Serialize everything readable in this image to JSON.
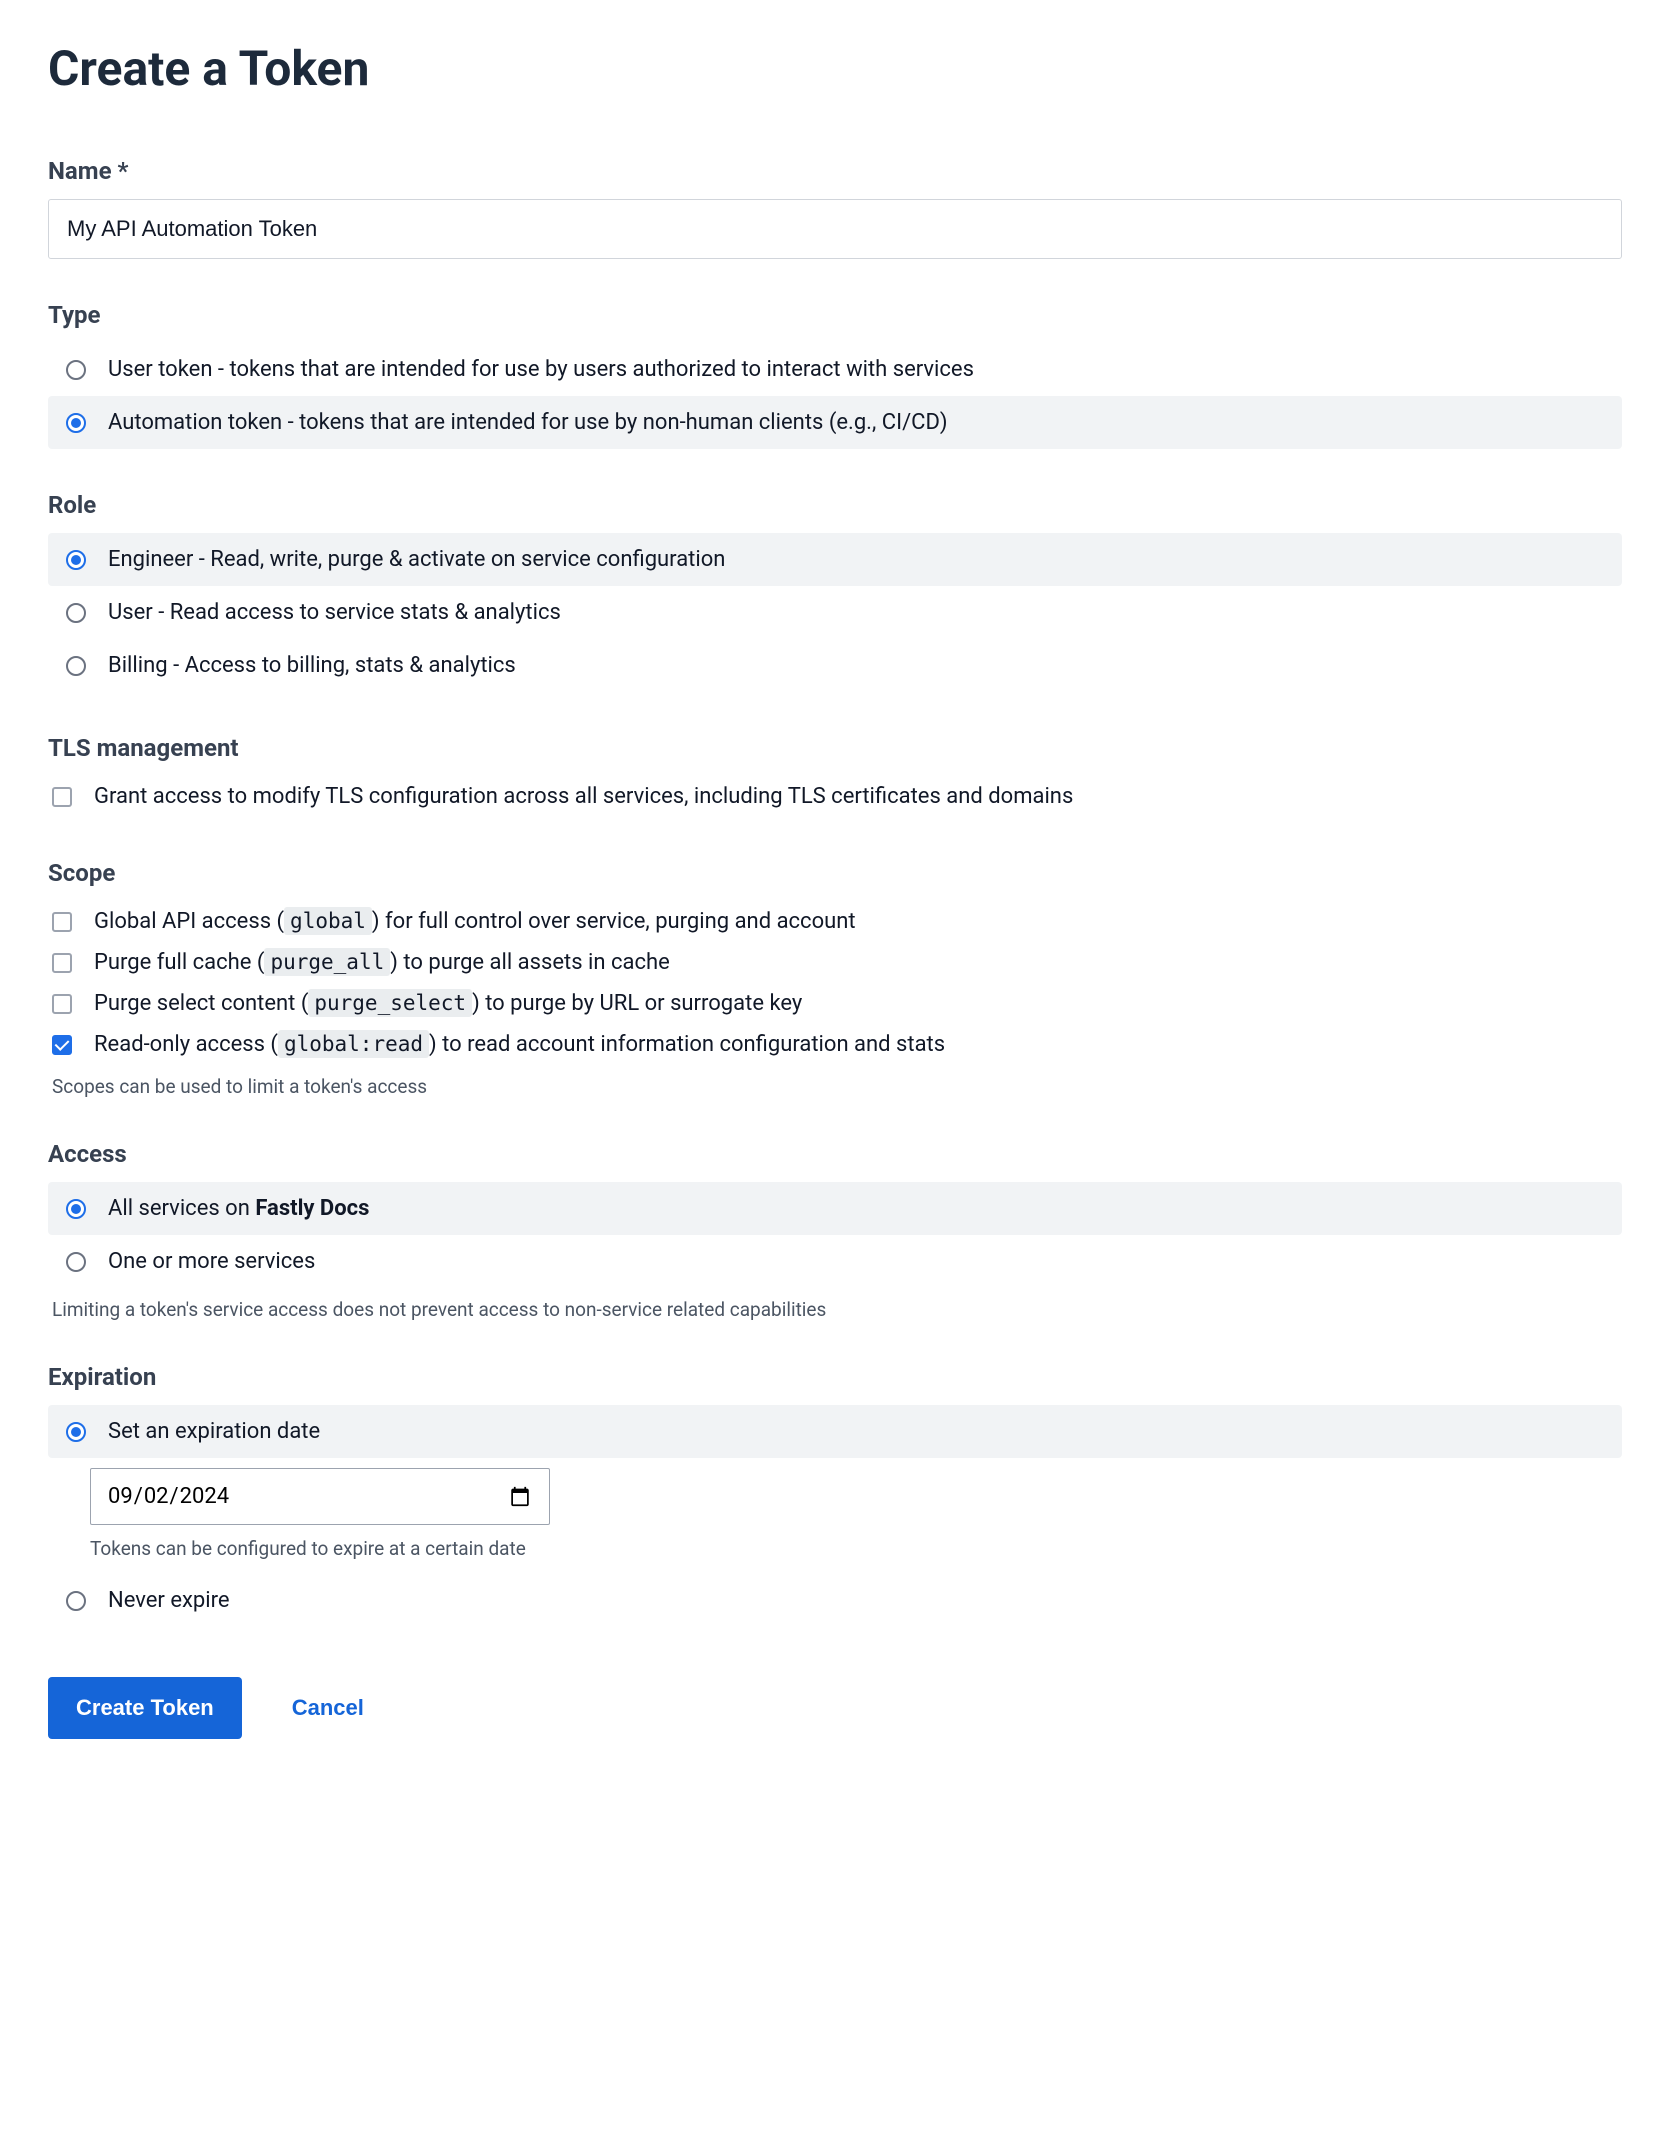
{
  "title": "Create a Token",
  "name_section": {
    "label": "Name *",
    "value": "My API Automation Token"
  },
  "type_section": {
    "label": "Type",
    "options": [
      {
        "text": "User token - tokens that are intended for use by users authorized to interact with services",
        "selected": false
      },
      {
        "text": "Automation token - tokens that are intended for use by non-human clients (e.g., CI/CD)",
        "selected": true
      }
    ]
  },
  "role_section": {
    "label": "Role",
    "options": [
      {
        "text": "Engineer - Read, write, purge & activate on service configuration",
        "selected": true
      },
      {
        "text": "User - Read access to service stats & analytics",
        "selected": false
      },
      {
        "text": "Billing - Access to billing, stats & analytics",
        "selected": false
      }
    ]
  },
  "tls_section": {
    "label": "TLS management",
    "option_text": "Grant access to modify TLS configuration across all services, including TLS certificates and domains",
    "checked": false
  },
  "scope_section": {
    "label": "Scope",
    "options": [
      {
        "prefix": "Global API access (",
        "code": "global",
        "suffix": ") for full control over service, purging and account",
        "checked": false
      },
      {
        "prefix": "Purge full cache (",
        "code": "purge_all",
        "suffix": ") to purge all assets in cache",
        "checked": false
      },
      {
        "prefix": "Purge select content (",
        "code": "purge_select",
        "suffix": ") to purge by URL or surrogate key",
        "checked": false
      },
      {
        "prefix": "Read-only access (",
        "code": "global:read",
        "suffix": ") to read account information configuration and stats",
        "checked": true
      }
    ],
    "helper": "Scopes can be used to limit a token's access"
  },
  "access_section": {
    "label": "Access",
    "options": [
      {
        "prefix": "All services on ",
        "bold": "Fastly Docs",
        "selected": true
      },
      {
        "prefix": "One or more services",
        "bold": "",
        "selected": false
      }
    ],
    "helper": "Limiting a token's service access does not prevent access to non-service related capabilities"
  },
  "expiration_section": {
    "label": "Expiration",
    "set_option": "Set an expiration date",
    "date_value": "2024-09-02",
    "date_helper": "Tokens can be configured to expire at a certain date",
    "never_option": "Never expire",
    "selected": "set"
  },
  "buttons": {
    "create": "Create Token",
    "cancel": "Cancel"
  }
}
